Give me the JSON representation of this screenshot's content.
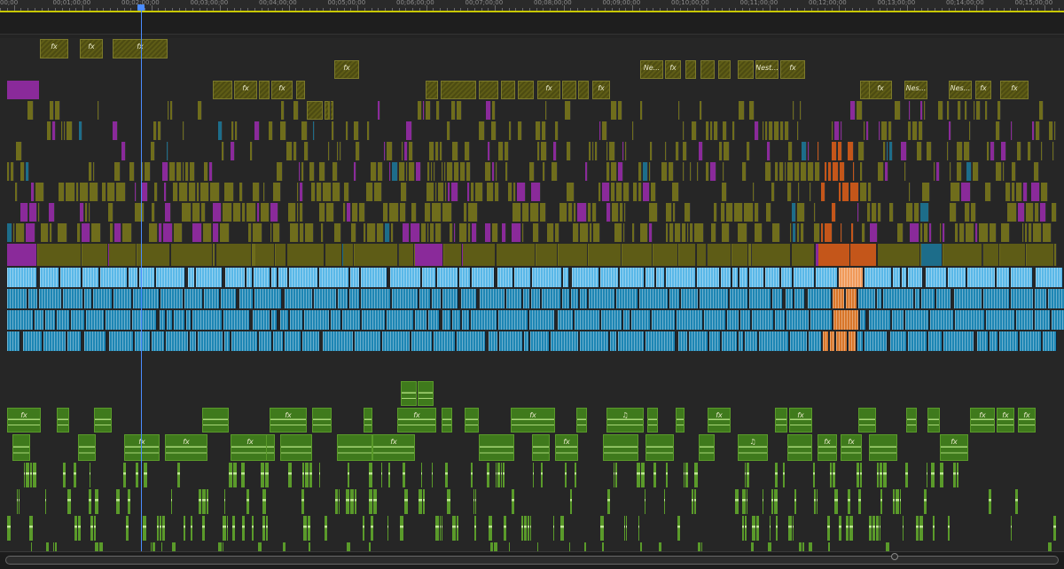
{
  "ruler": {
    "timecodes": [
      "00;00",
      "00;01;00;00",
      "00;02;00;00",
      "00;03;00;00",
      "00;04;00;00",
      "00;05;00;00",
      "00;06;00;00",
      "00;07;00;00",
      "00;08;00;00",
      "00;09;00;00",
      "00;10;00;00",
      "00;11;00;00",
      "00;12;00;00",
      "00;13;00;00",
      "00;14;00;00",
      "00;15;00;00"
    ],
    "work_area_color": "#c8c800"
  },
  "playhead": {
    "timecode_index": 1.9,
    "color": "#4a8cff"
  },
  "colors": {
    "video_olive": "#5e5c16",
    "video_olive_light": "#6f6d1c",
    "video_purple": "#8a2a9a",
    "video_orange": "#c4561a",
    "video_teal": "#1d6d8a",
    "audio_blue_light": "#5ab8e8",
    "audio_blue": "#1e86b4",
    "audio_orange": "#d8762a",
    "audio_green": "#3f7a1c",
    "audio_green_wave": "#a8d878",
    "track_bg": "#262626"
  },
  "clip_labels": {
    "fx": "fx",
    "nest": "Nes...",
    "nested": "Nest...",
    "ne": "Ne...",
    "music": "♫"
  },
  "icons": [
    "playhead-icon",
    "music-note-icon",
    "scroll-handle-icon"
  ]
}
